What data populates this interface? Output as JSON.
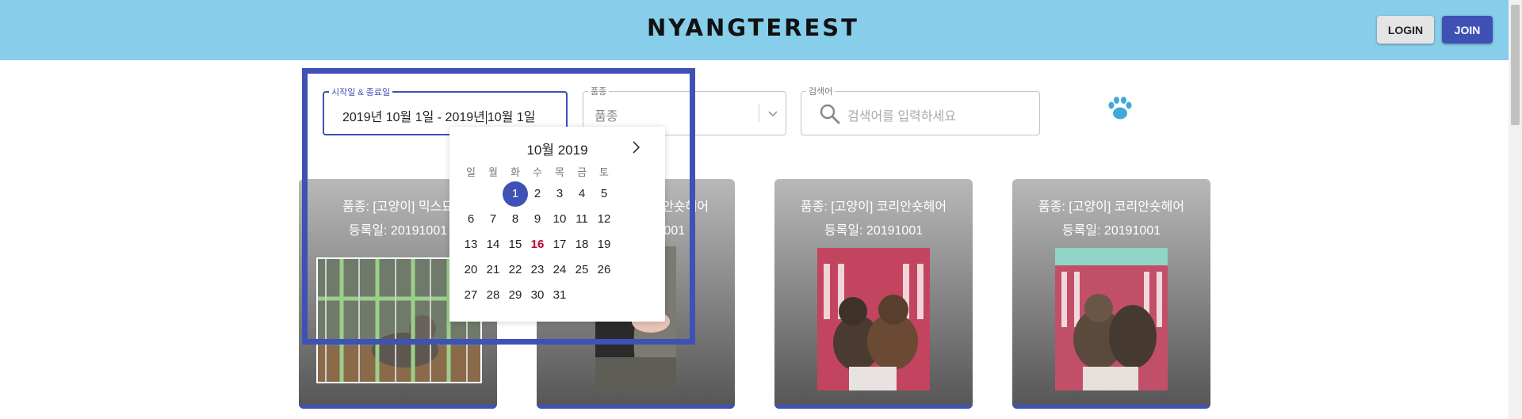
{
  "header": {
    "logo": "NYANGTEREST",
    "login_label": "LOGIN",
    "join_label": "JOIN",
    "background": "#87ceeb",
    "accent": "#3f51b5"
  },
  "filters": {
    "date": {
      "label": "시작일 & 종료일",
      "value_start": "2019년 10월 1일  -  2019년",
      "value_end": "10월 1일"
    },
    "breed": {
      "label": "품종",
      "value": "품종"
    },
    "search": {
      "label": "검색어",
      "placeholder": "검색어를 입력하세요"
    },
    "paw_icon": "paw-icon"
  },
  "calendar": {
    "title": "10월 2019",
    "weekdays": [
      "일",
      "월",
      "화",
      "수",
      "목",
      "금",
      "토"
    ],
    "selected_day": "1",
    "today": "16",
    "weeks": [
      [
        "",
        "",
        "1",
        "2",
        "3",
        "4",
        "5"
      ],
      [
        "6",
        "7",
        "8",
        "9",
        "10",
        "11",
        "12"
      ],
      [
        "13",
        "14",
        "15",
        "16",
        "17",
        "18",
        "19"
      ],
      [
        "20",
        "21",
        "22",
        "23",
        "24",
        "25",
        "26"
      ],
      [
        "27",
        "28",
        "29",
        "30",
        "31",
        "",
        ""
      ]
    ]
  },
  "cards": [
    {
      "breed": "품종: [고양이] 믹스묘",
      "date": "등록일: 20191001"
    },
    {
      "breed": "품종: [고양이] 코리안숏헤어",
      "date": "등록일: 20191001"
    },
    {
      "breed": "품종: [고양이] 코리안숏헤어",
      "date": "등록일: 20191001"
    },
    {
      "breed": "품종: [고양이] 코리안숏헤어",
      "date": "등록일: 20191001"
    }
  ]
}
